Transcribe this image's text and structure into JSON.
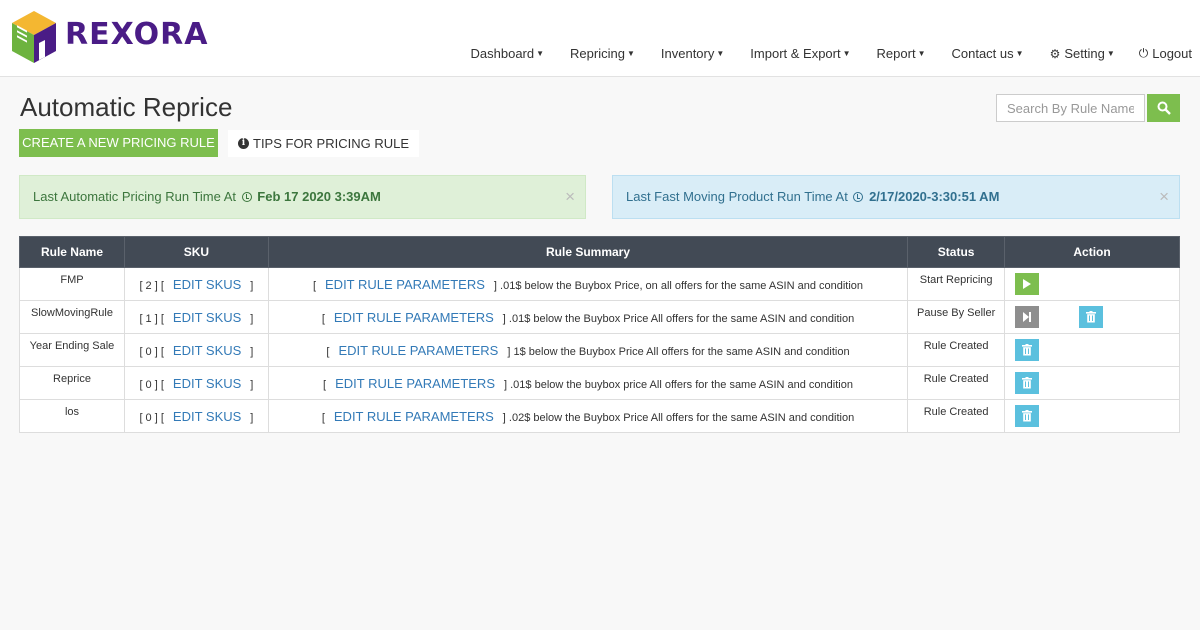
{
  "brand": {
    "name": "REXORA"
  },
  "nav": [
    {
      "label": "Dashboard",
      "caret": true
    },
    {
      "label": "Repricing",
      "caret": true
    },
    {
      "label": "Inventory",
      "caret": true
    },
    {
      "label": "Import & Export",
      "caret": true
    },
    {
      "label": "Report",
      "caret": true
    },
    {
      "label": "Contact us",
      "caret": true
    },
    {
      "label": "Setting",
      "caret": true,
      "icon": "gear-icon"
    },
    {
      "label": "Logout",
      "caret": false,
      "icon": "power-icon"
    }
  ],
  "page": {
    "title": "Automatic Reprice",
    "create_button": "CREATE A NEW PRICING RULE",
    "tips_button": "TIPS FOR PRICING RULE",
    "search_placeholder": "Search By Rule Name"
  },
  "alerts": {
    "automatic": {
      "text": "Last Automatic Pricing Run Time At",
      "time": "Feb 17 2020 3:39AM",
      "close": "×"
    },
    "fast_moving": {
      "text": "Last Fast Moving Product Run Time At",
      "time": "2/17/2020-3:30:51 AM",
      "close": "×"
    }
  },
  "table": {
    "headers": [
      "Rule Name",
      "SKU",
      "Rule Summary",
      "Status",
      "Action"
    ],
    "edit_skus_label": "EDIT SKUS",
    "edit_params_label": "EDIT RULE PARAMETERS",
    "rows": [
      {
        "name": "FMP",
        "sku_count": "[ 2 ] [",
        "summary": ".01$ below the Buybox Price, on all offers for the same ASIN and condition",
        "status": "Start Repricing",
        "actions": [
          "play-icon"
        ]
      },
      {
        "name": "SlowMovingRule",
        "sku_count": "[ 1 ] [",
        "summary": ".01$ below the Buybox Price All offers for the same ASIN and condition",
        "status": "Pause By Seller",
        "actions": [
          "step-forward-icon",
          "trash-icon"
        ]
      },
      {
        "name": "Year Ending Sale",
        "sku_count": "[ 0 ] [",
        "summary": "1$ below the Buybox Price All offers for the same ASIN and condition",
        "status": "Rule Created",
        "actions": [
          "trash-icon"
        ]
      },
      {
        "name": "Reprice",
        "sku_count": "[ 0 ] [",
        "summary": ".01$ below the buybox price All offers for the same ASIN and condition",
        "status": "Rule Created",
        "actions": [
          "trash-icon"
        ]
      },
      {
        "name": "los",
        "sku_count": "[ 0 ] [",
        "summary": ".02$ below the Buybox Price All offers for the same ASIN and condition",
        "status": "Rule Created",
        "actions": [
          "trash-icon"
        ]
      }
    ]
  },
  "colors": {
    "brand": "#4a1c86",
    "success": "#7dbe4e",
    "info": "#5bc0de",
    "header": "#424a55",
    "link": "#337ab7"
  }
}
